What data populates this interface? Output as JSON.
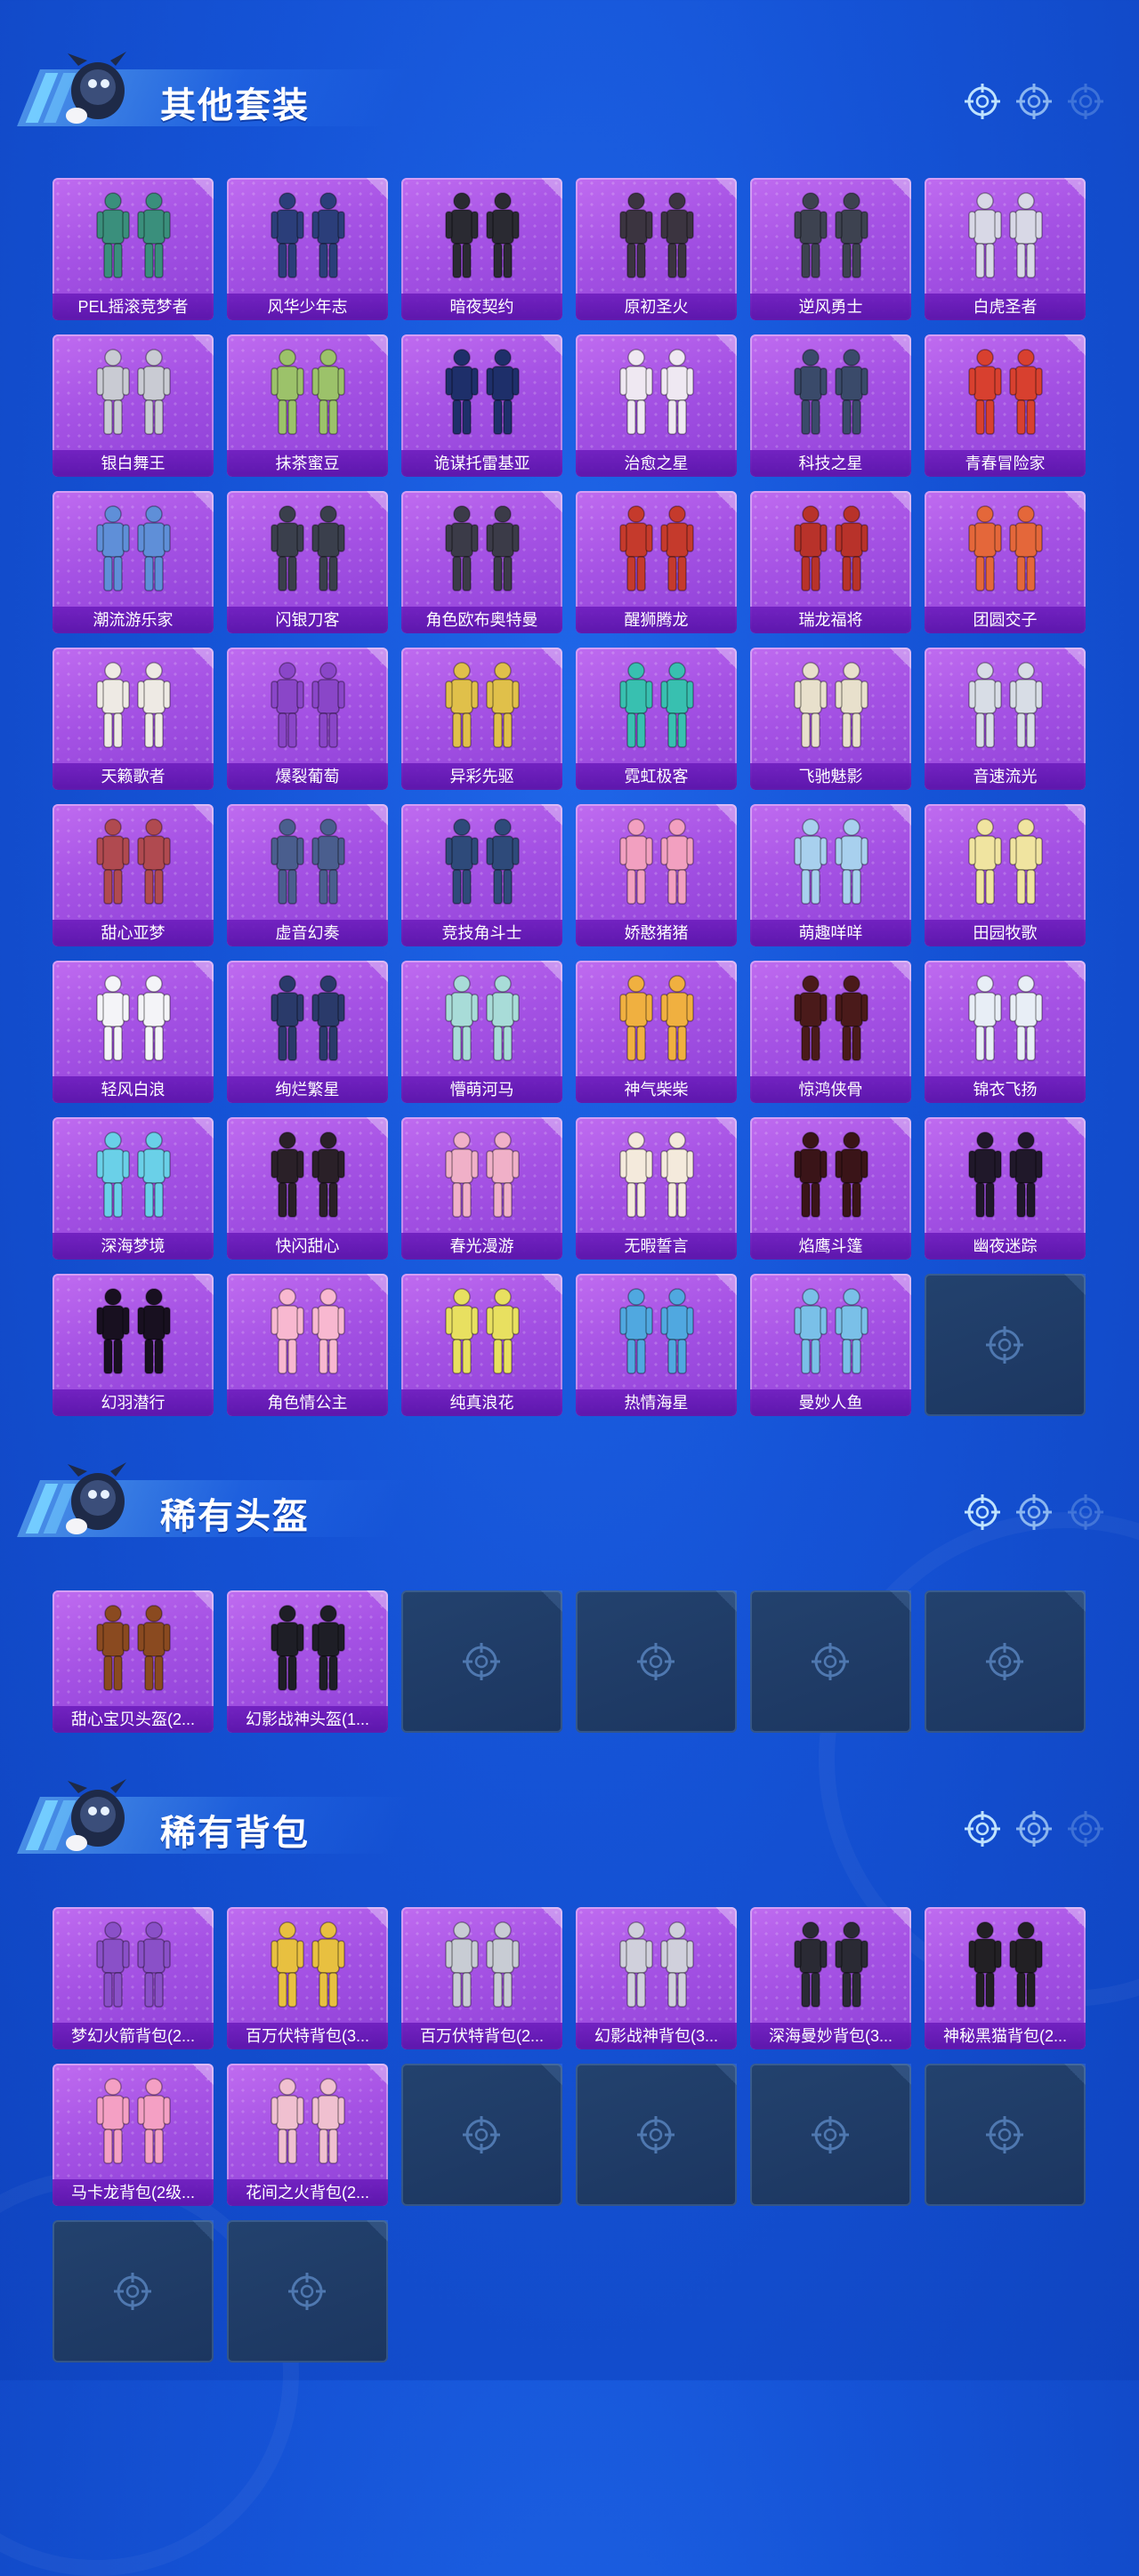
{
  "sections": [
    {
      "title": "其他套装",
      "items": [
        {
          "label": "PEL摇滚竞梦者",
          "color": "#3a8f7c"
        },
        {
          "label": "风华少年志",
          "color": "#2b3e7a"
        },
        {
          "label": "暗夜契约",
          "color": "#2a2a32"
        },
        {
          "label": "原初圣火",
          "color": "#3b3440"
        },
        {
          "label": "逆风勇士",
          "color": "#3d4250"
        },
        {
          "label": "白虎圣者",
          "color": "#d8d8e6"
        },
        {
          "label": "银白舞王",
          "color": "#c9cbd3"
        },
        {
          "label": "抹茶蜜豆",
          "color": "#9cc26a"
        },
        {
          "label": "诡谋托雷基亚",
          "color": "#1e2f6a"
        },
        {
          "label": "治愈之星",
          "color": "#efe8f2"
        },
        {
          "label": "科技之星",
          "color": "#3a4a6a"
        },
        {
          "label": "青春冒险家",
          "color": "#d8402f"
        },
        {
          "label": "潮流游乐家",
          "color": "#5f8fd8"
        },
        {
          "label": "闪银刀客",
          "color": "#3a3f4c"
        },
        {
          "label": "角色欧布奥特曼",
          "color": "#3b3b48"
        },
        {
          "label": "醒狮腾龙",
          "color": "#c53a2c"
        },
        {
          "label": "瑞龙福将",
          "color": "#b8322a"
        },
        {
          "label": "团圆交子",
          "color": "#e4673a"
        },
        {
          "label": "天籁歌者",
          "color": "#eeeae4"
        },
        {
          "label": "爆裂葡萄",
          "color": "#8a46c8"
        },
        {
          "label": "异彩先驱",
          "color": "#e0c04a"
        },
        {
          "label": "霓虹极客",
          "color": "#38c0b0"
        },
        {
          "label": "飞驰魅影",
          "color": "#e8e0cc"
        },
        {
          "label": "音速流光",
          "color": "#d8dde6"
        },
        {
          "label": "甜心亚梦",
          "color": "#b04a50"
        },
        {
          "label": "虚音幻奏",
          "color": "#4a5e8e"
        },
        {
          "label": "竞技角斗士",
          "color": "#2e4a7a"
        },
        {
          "label": "娇憨猪猪",
          "color": "#f2a0c0"
        },
        {
          "label": "萌趣咩咩",
          "color": "#a8d0ee"
        },
        {
          "label": "田园牧歌",
          "color": "#f0e4a0"
        },
        {
          "label": "轻风白浪",
          "color": "#f4f4f8"
        },
        {
          "label": "绚烂繁星",
          "color": "#2a3a6a"
        },
        {
          "label": "懵萌河马",
          "color": "#a8dcd8"
        },
        {
          "label": "神气柴柴",
          "color": "#f0b040"
        },
        {
          "label": "惊鸿侠骨",
          "color": "#4a1a1a"
        },
        {
          "label": "锦衣飞扬",
          "color": "#e8eef6"
        },
        {
          "label": "深海梦境",
          "color": "#6ad0e8"
        },
        {
          "label": "快闪甜心",
          "color": "#2a2028"
        },
        {
          "label": "春光漫游",
          "color": "#f0b0c8"
        },
        {
          "label": "无暇誓言",
          "color": "#f4eadc"
        },
        {
          "label": "焰鹰斗篷",
          "color": "#3a1418"
        },
        {
          "label": "幽夜迷踪",
          "color": "#20182a"
        },
        {
          "label": "幻羽潜行",
          "color": "#181020"
        },
        {
          "label": "角色情公主",
          "color": "#f8b8d0"
        },
        {
          "label": "纯真浪花",
          "color": "#e8e060"
        },
        {
          "label": "热情海星",
          "color": "#50a8e0"
        },
        {
          "label": "曼妙人鱼",
          "color": "#7ac0e8"
        }
      ],
      "empty_slots": 1
    },
    {
      "title": "稀有头盔",
      "items": [
        {
          "label": "甜心宝贝头盔(2...",
          "color": "#8a4a20"
        },
        {
          "label": "幻影战神头盔(1...",
          "color": "#1e1e26"
        }
      ],
      "empty_slots": 4
    },
    {
      "title": "稀有背包",
      "items": [
        {
          "label": "梦幻火箭背包(2...",
          "color": "#8a50c8"
        },
        {
          "label": "百万伏特背包(3...",
          "color": "#e8c040"
        },
        {
          "label": "百万伏特背包(2...",
          "color": "#c8ccd4"
        },
        {
          "label": "幻影战神背包(3...",
          "color": "#d0d0dc"
        },
        {
          "label": "深海曼妙背包(3...",
          "color": "#2a2a34"
        },
        {
          "label": "神秘黑猫背包(2...",
          "color": "#222024"
        },
        {
          "label": "马卡龙背包(2级...",
          "color": "#f4a0c4"
        },
        {
          "label": "花间之火背包(2...",
          "color": "#f0c0d0"
        }
      ],
      "empty_slots": 6
    }
  ]
}
